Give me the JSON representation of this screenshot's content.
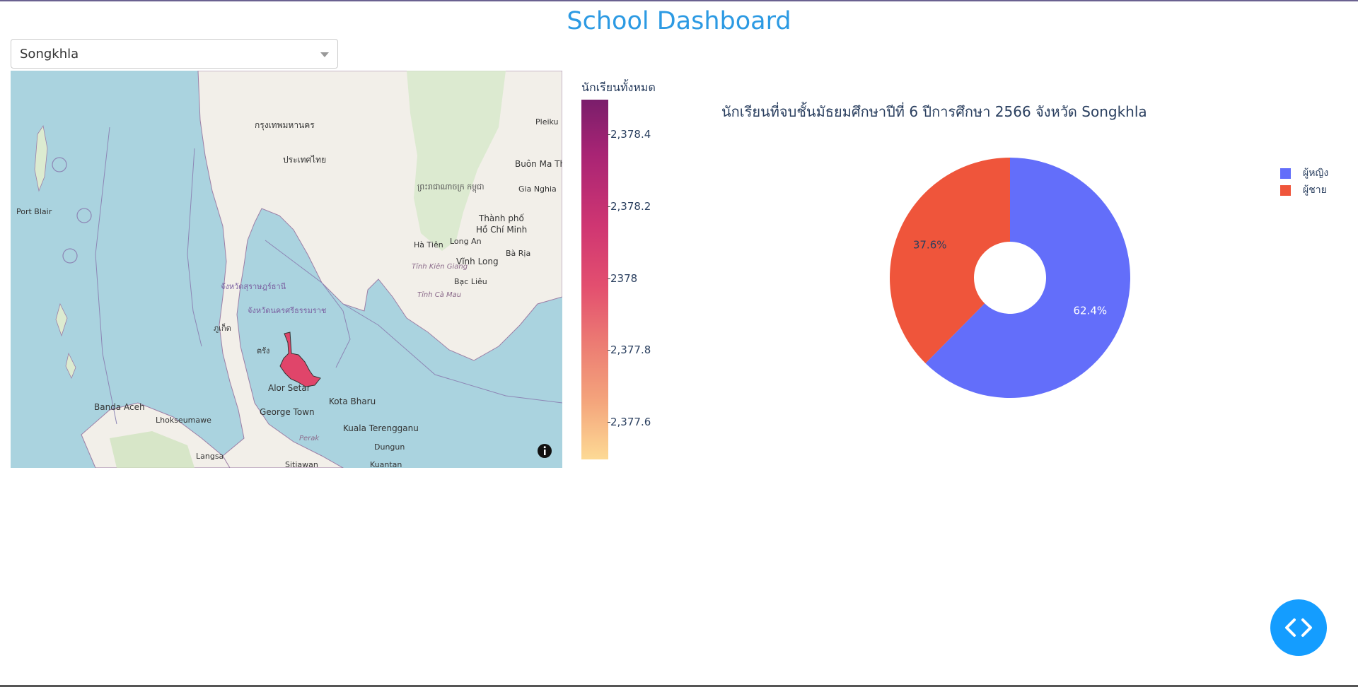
{
  "page": {
    "title": "School Dashboard"
  },
  "province_dropdown": {
    "selected": "Songkhla"
  },
  "map": {
    "labels": {
      "bangkok": "กรุงเทพมหานคร",
      "thailand": "ประเทศไทย",
      "cambodia": "ព្រះរាជាណាចក្រ កម្ពុជា",
      "port_blair": "Port Blair",
      "pleiku": "Pleiku",
      "buon_ma_thuot": "Buôn Ma Th",
      "gia_nghia": "Gia Nghia",
      "hcmc_1": "Thành phố",
      "hcmc_2": "Hồ Chí Minh",
      "long_an": "Long An",
      "ha_tien": "Hà Tiên",
      "vinh_long": "Vĩnh Long",
      "ba_ria": "Bà Rịa",
      "tinh_kien_giang": "Tỉnh Kiên Giang",
      "bac_lieu": "Bạc Liêu",
      "tinh_ca_mau": "Tỉnh Cà Mau",
      "phuket": "ภูเก็ต",
      "trang": "ตรัง",
      "alor_setar": "Alor Setar",
      "kota_bharu": "Kota Bharu",
      "george_town": "George Town",
      "kuala_terengganu": "Kuala Terengganu",
      "banda_aceh": "Banda Aceh",
      "lhokseumawe": "Lhokseumawe",
      "perak": "Perak",
      "dungun": "Dungun",
      "langsa": "Langsa",
      "sitiawan": "Sitiawan",
      "kuantan": "Kuantan",
      "surat_thani": "จังหวัดสุราษฎร์ธานี",
      "nakhon_si": "จังหวัดนครศรีธรรมราช"
    }
  },
  "colorbar": {
    "title": "นักเรียนทั้งหมด",
    "ticks": [
      "2,378.4",
      "2,378.2",
      "2378",
      "2,377.8",
      "2,377.6"
    ]
  },
  "chart_data": {
    "type": "pie",
    "title": "นักเรียนที่จบชั้นมัธยมศึกษาปีที่ 6 ปีการศึกษา 2566 จังหวัด Songkhla",
    "hole": 0.3,
    "labels": [
      "ผู้หญิง",
      "ผู้ชาย"
    ],
    "values": [
      62.4,
      37.6
    ],
    "value_labels": [
      "62.4%",
      "37.6%"
    ],
    "colors": [
      "#636efa",
      "#ef553b"
    ],
    "legend_position": "top-right"
  },
  "colors": {
    "title": "#2c9ae3",
    "fab": "#149dff",
    "highlight_region": "#e0456a"
  }
}
